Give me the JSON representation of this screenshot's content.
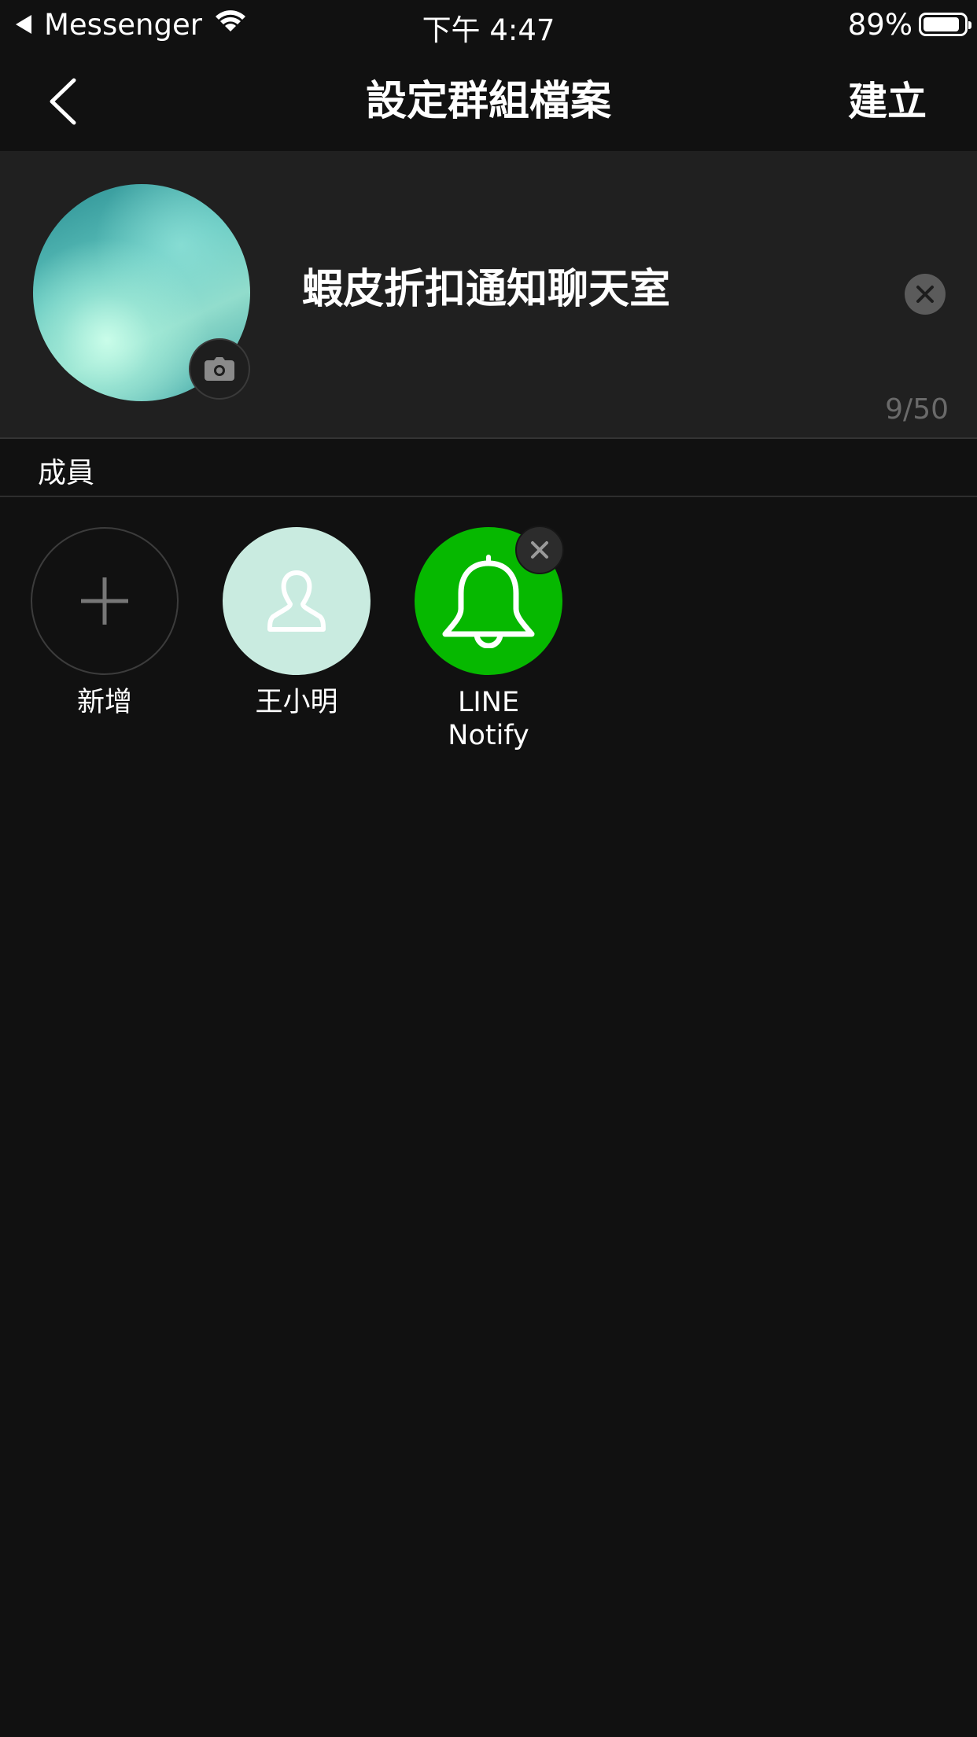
{
  "status_bar": {
    "back_app": "Messenger",
    "time": "下午 4:47",
    "battery_percent": "89%",
    "battery_level": 0.89
  },
  "nav": {
    "title": "設定群組檔案",
    "create_label": "建立"
  },
  "profile": {
    "group_name": "蝦皮折扣通知聊天室",
    "char_count": "9/50"
  },
  "members": {
    "section_label": "成員",
    "items": [
      {
        "label": "新增",
        "kind": "add"
      },
      {
        "label": "王小明",
        "kind": "user"
      },
      {
        "label_line1": "LINE",
        "label_line2": "Notify",
        "kind": "bot"
      }
    ]
  },
  "colors": {
    "background": "#111111",
    "profile_bg": "#202020",
    "notify_green": "#06b800",
    "user_avatar_bg": "#c9ebe0"
  },
  "icons": [
    "back-arrow-icon",
    "wifi-icon",
    "battery-icon",
    "chevron-left-icon",
    "camera-icon",
    "clear-icon",
    "plus-icon",
    "person-icon",
    "bell-icon",
    "remove-icon"
  ]
}
